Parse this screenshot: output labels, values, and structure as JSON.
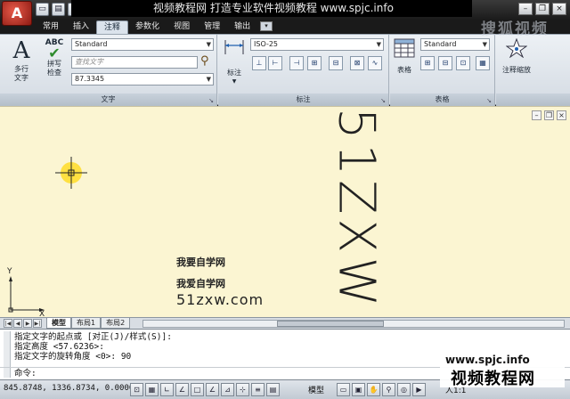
{
  "titlebar": {
    "app_button_glyph": "A",
    "banner_text": "视频教程网 打造专业软件视频教程   www.spjc.info",
    "qat_icons": [
      "new-icon",
      "open-icon",
      "save-icon",
      "undo-icon",
      "redo-icon",
      "plot-icon"
    ],
    "watermark_top": "搜狐视频"
  },
  "tabs": [
    {
      "label": "常用",
      "active": false
    },
    {
      "label": "插入",
      "active": false
    },
    {
      "label": "注释",
      "active": true
    },
    {
      "label": "参数化",
      "active": false
    },
    {
      "label": "视图",
      "active": false
    },
    {
      "label": "管理",
      "active": false
    },
    {
      "label": "输出",
      "active": false
    }
  ],
  "ribbon": {
    "text_panel": {
      "title": "文字",
      "multiline_label_1": "多行",
      "multiline_label_2": "文字",
      "spell_label_1": "拼写",
      "spell_label_2": "检查",
      "abc_glyph": "ABC",
      "style_value": "Standard",
      "find_placeholder": "查找文字",
      "height_value": "87.3345"
    },
    "dim_panel": {
      "title": "标注",
      "dim_label": "标注",
      "style_value": "ISO-25"
    },
    "table_panel": {
      "title": "表格",
      "table_label": "表格",
      "style_value": "Standard"
    },
    "scale_panel": {
      "label": "注释缩放"
    }
  },
  "drawing": {
    "text_line_1": "我要自学网",
    "text_line_2": "我爱自学网",
    "text_line_3": "51zxw.com",
    "rotated_text": "51ZXW",
    "ucs_y": "Y",
    "ucs_x": "X"
  },
  "layout_tabs": [
    {
      "label": "模型",
      "active": true
    },
    {
      "label": "布局1",
      "active": false
    },
    {
      "label": "布局2",
      "active": false
    }
  ],
  "command": {
    "lines": [
      "指定文字的起点或 [对正(J)/样式(S)]:",
      "指定高度 <57.6236>:",
      "指定文字的旋转角度 <0>: 90"
    ],
    "prompt": "命令:"
  },
  "overlay": {
    "url": "www.spjc.info",
    "name": "视频教程网"
  },
  "status": {
    "coords": "845.8748,  1336.8734, 0.0000",
    "model_label": "模型",
    "scale_label": "人1:1"
  }
}
